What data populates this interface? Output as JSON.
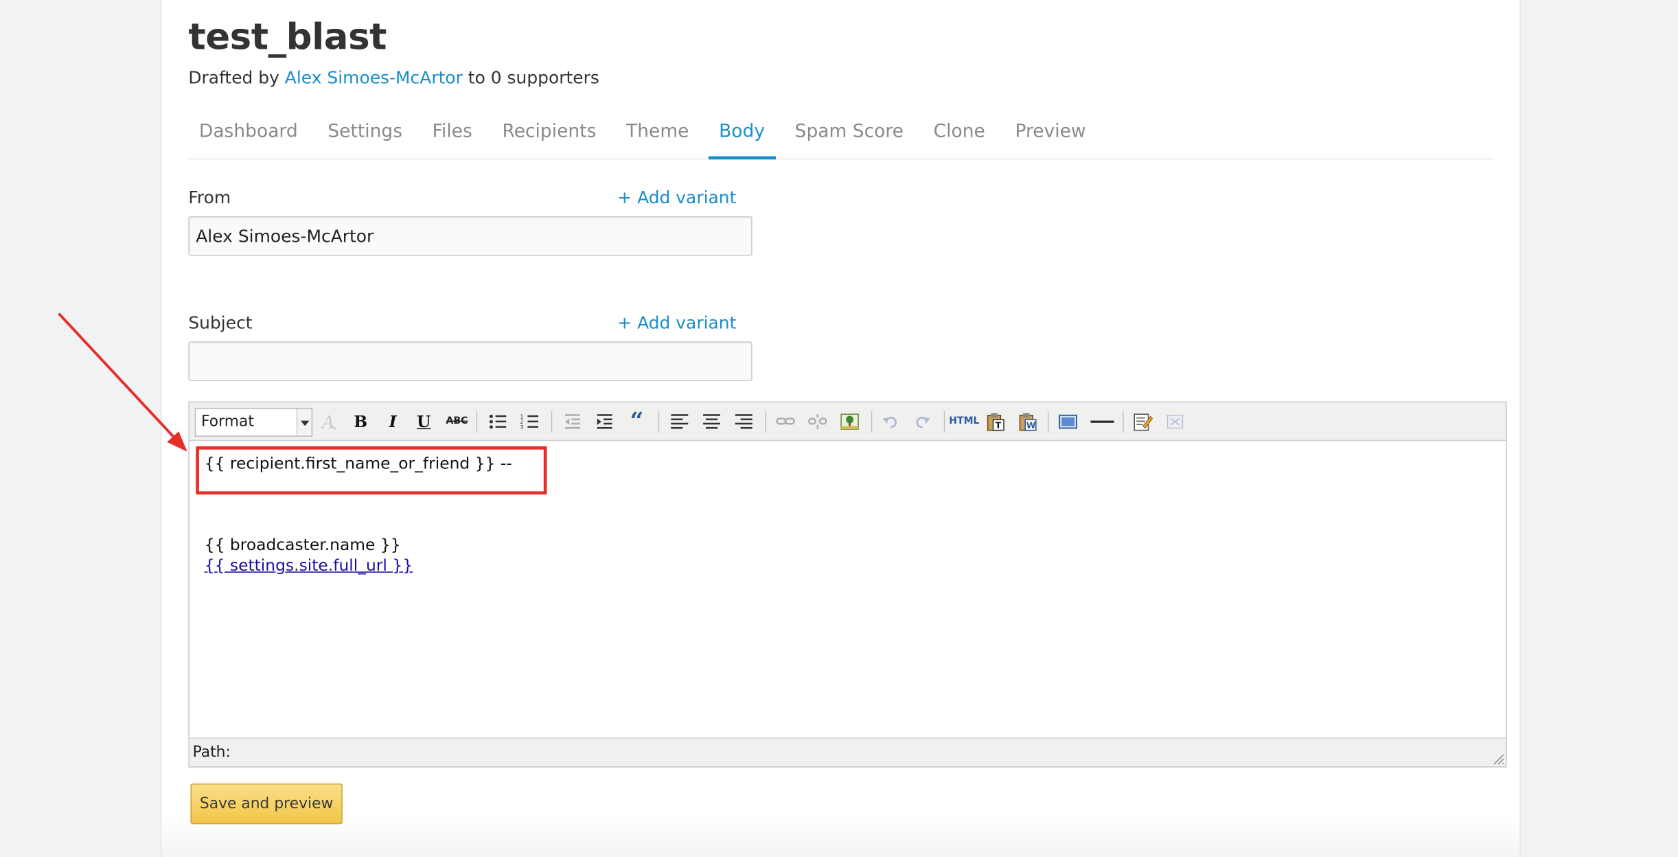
{
  "blast": {
    "title": "test_blast",
    "byline_prefix": "Drafted by ",
    "author": "Alex Simoes-McArtor",
    "byline_suffix": " to 0 supporters"
  },
  "tabs": [
    {
      "label": "Dashboard",
      "active": false
    },
    {
      "label": "Settings",
      "active": false
    },
    {
      "label": "Files",
      "active": false
    },
    {
      "label": "Recipients",
      "active": false
    },
    {
      "label": "Theme",
      "active": false
    },
    {
      "label": "Body",
      "active": true
    },
    {
      "label": "Spam Score",
      "active": false
    },
    {
      "label": "Clone",
      "active": false
    },
    {
      "label": "Preview",
      "active": false
    }
  ],
  "from_field": {
    "label": "From",
    "variant_link": "+ Add variant",
    "value": "Alex Simoes-McArtor"
  },
  "subject_field": {
    "label": "Subject",
    "variant_link": "+ Add variant",
    "value": ""
  },
  "editor": {
    "format_select": "Format",
    "toolbar_icons": [
      "text-color-icon",
      "bold-icon",
      "italic-icon",
      "underline-icon",
      "strikethrough-icon",
      "bullet-list-icon",
      "numbered-list-icon",
      "outdent-icon",
      "indent-icon",
      "blockquote-icon",
      "align-left-icon",
      "align-center-icon",
      "align-right-icon",
      "link-icon",
      "unlink-icon",
      "image-icon",
      "undo-icon",
      "redo-icon",
      "html-source-icon",
      "paste-text-icon",
      "paste-word-icon",
      "fullscreen-icon",
      "horizontal-rule-icon",
      "edit-icon",
      "cleanup-icon"
    ],
    "html_label": "HTML",
    "bold_label": "B",
    "italic_label": "I",
    "underline_label": "U",
    "strike_label": "ABC",
    "quote_label": "“",
    "content": {
      "line1": "{{ recipient.first_name_or_friend }} --",
      "line2": "{{ broadcaster.name }}",
      "line3": "{{ settings.site.full_url }}"
    },
    "path_label": "Path:"
  },
  "save_button": "Save and preview",
  "colors": {
    "accent": "#1b8ec9",
    "annotation": "#e5302a",
    "button": "#f2c646"
  }
}
